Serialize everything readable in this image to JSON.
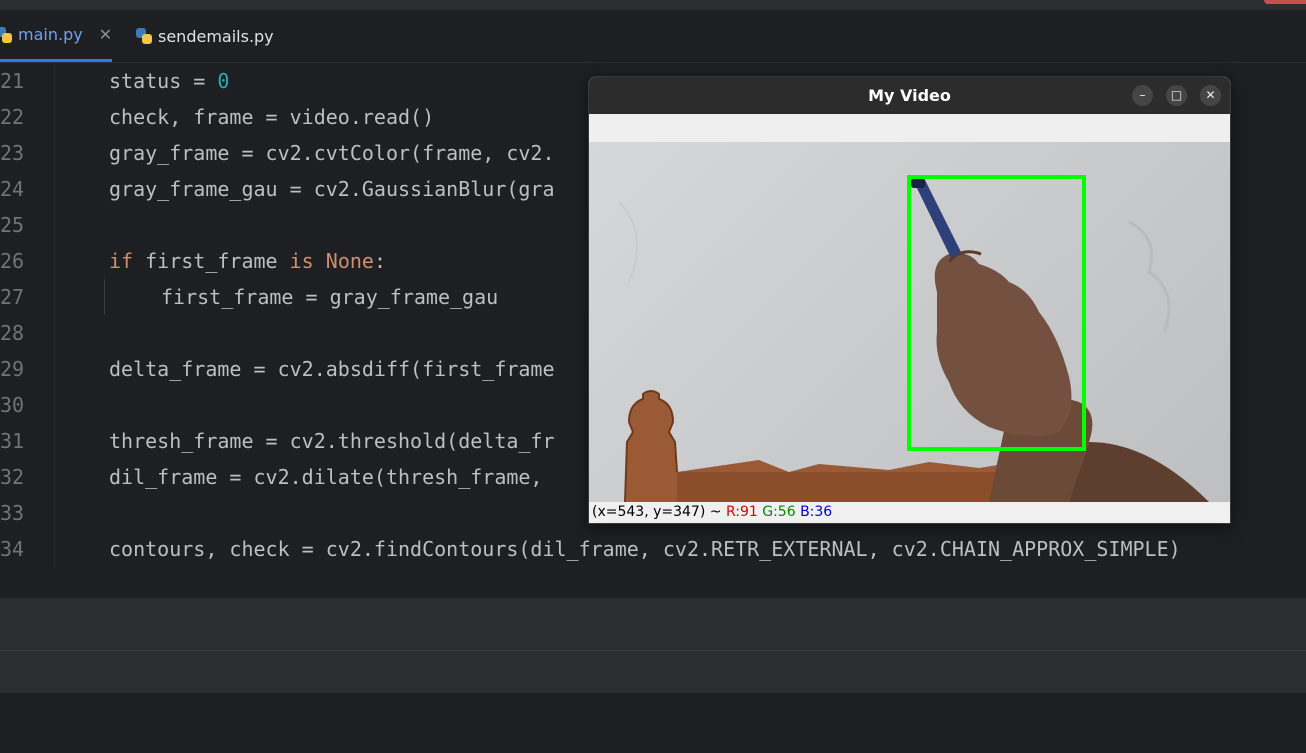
{
  "tabs": [
    {
      "label": "main.py",
      "active": true,
      "closable": true
    },
    {
      "label": "sendemails.py",
      "active": false,
      "closable": false
    }
  ],
  "icons": {
    "tab_icon": "python-file-icon",
    "tab_close": "close-icon"
  },
  "editor": {
    "lines": [
      {
        "num": "21",
        "code": "status = 0"
      },
      {
        "num": "22",
        "code": "check, frame = video.read()"
      },
      {
        "num": "23",
        "code": "gray_frame = cv2.cvtColor(frame, cv2."
      },
      {
        "num": "24",
        "code": "gray_frame_gau = cv2.GaussianBlur(gra"
      },
      {
        "num": "25",
        "code": ""
      },
      {
        "num": "26",
        "code": "if first_frame is None:"
      },
      {
        "num": "27",
        "code": "first_frame = gray_frame_gau"
      },
      {
        "num": "28",
        "code": ""
      },
      {
        "num": "29",
        "code": "delta_frame = cv2.absdiff(first_frame"
      },
      {
        "num": "30",
        "code": ""
      },
      {
        "num": "31",
        "code": "thresh_frame = cv2.threshold(delta_fr"
      },
      {
        "num": "32",
        "code": "dil_frame = cv2.dilate(thresh_frame, "
      },
      {
        "num": "33",
        "code": ""
      },
      {
        "num": "34",
        "code": "contours, check = cv2.findContours(dil_frame, cv2.RETR_EXTERNAL, cv2.CHAIN_APPROX_SIMPLE)"
      }
    ],
    "tokens": {
      "status_assign": "status = ",
      "zero": "0",
      "kw_if": "if",
      "first_frame_var": " first_frame ",
      "kw_is": "is",
      "kw_none": "None",
      "colon": ":"
    }
  },
  "video_window": {
    "title": "My Video",
    "buttons": {
      "minimize": "–",
      "maximize": "□",
      "close": "✕"
    },
    "status": {
      "coords": "(x=543, y=347) ~ ",
      "r": "R:91",
      "g": "G:56",
      "b": "B:36"
    },
    "box_color": "#00ff00"
  },
  "colors": {
    "editor_bg": "#1e1f22",
    "keyword": "#cf8e6d",
    "number": "#2aacb8",
    "text": "#bcbec4",
    "line_number": "#6f737a",
    "tab_accent": "#3574f0"
  }
}
